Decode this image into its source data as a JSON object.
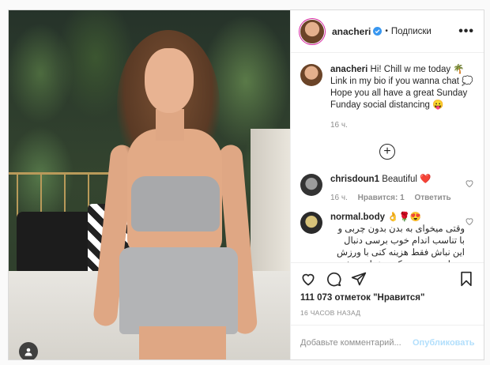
{
  "post": {
    "author": "anacheri",
    "follow_label": "Подписки",
    "more_label": "•••",
    "caption_username": "anacheri",
    "caption_text": "Hi! Chill w me today 🌴 Link in my bio if you wanna chat 💭 Hope you all have a great Sunday Funday social distancing 😛",
    "caption_time": "16 ч.",
    "load_more_label": "+"
  },
  "comments": [
    {
      "username": "chrisdoun1",
      "text": "Beautiful ❤️",
      "time": "16 ч.",
      "likes_label": "Нравится: 1",
      "reply_label": "Ответить"
    },
    {
      "username": "normal.body",
      "text": "👌🌹😍",
      "rtl_text": "وقتی میخوای به بدن بدون چربی و با تناسب اندام خوب برسی دنبال این نباش فقط هزینه کنی با ورزش به راحتی همونی که میخوای میشی . تمام"
    }
  ],
  "actions": {
    "likes": "111 073 отметок \"Нравится\"",
    "timestamp": "16 ЧАСОВ НАЗАД"
  },
  "add_comment": {
    "placeholder": "Добавьте комментарий...",
    "publish_label": "Опубликовать"
  },
  "colors": {
    "verified": "#3897f0",
    "heart": "#ed4956",
    "publish_disabled": "#b2dffc"
  },
  "icons": [
    "user-tag-icon",
    "verified-badge-icon",
    "more-options-icon",
    "heart-icon",
    "comment-icon",
    "share-icon",
    "bookmark-icon",
    "plus-circle-icon"
  ]
}
